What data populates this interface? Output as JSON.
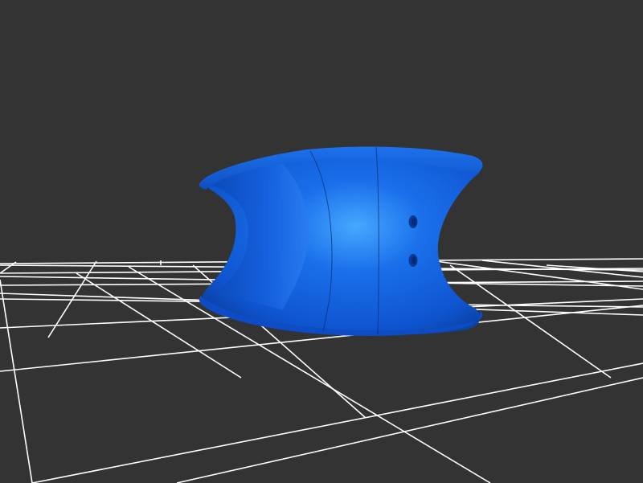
{
  "viewer": {
    "background_color": "#333333",
    "grid_color": "#ffffff",
    "model_color": "#1565e0",
    "model_highlight_color": "#3fa0ff",
    "model_shadow_color": "#0b3f9e"
  },
  "model": {
    "name": "",
    "seam_count": 3,
    "hole_count": 2
  }
}
